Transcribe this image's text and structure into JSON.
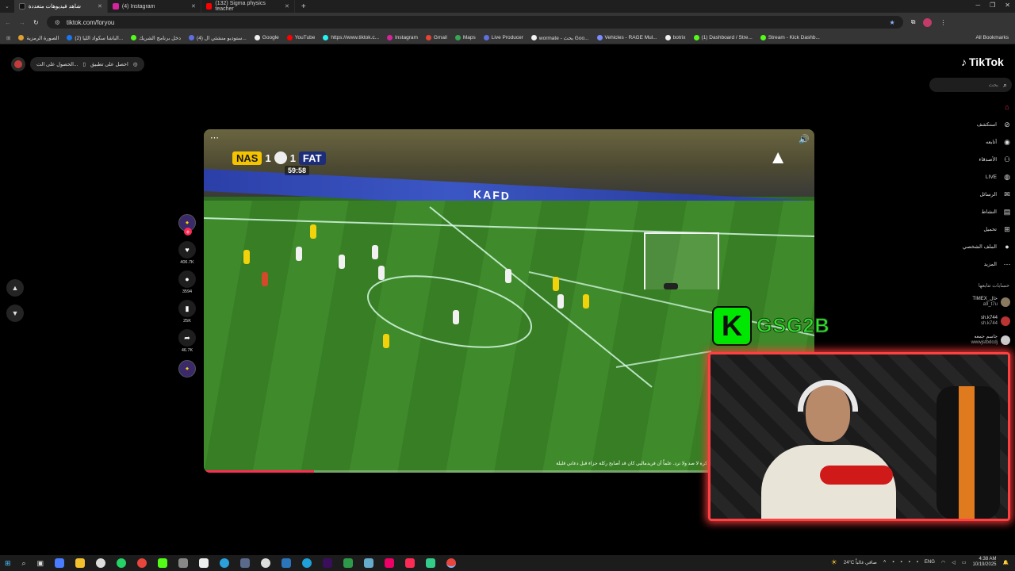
{
  "browser": {
    "tabs": [
      {
        "title": "شاهد فيديوهات متعددة",
        "active": true
      },
      {
        "title": "(4) Instagram",
        "active": false
      },
      {
        "title": "(132) Sigma physics teacher",
        "active": false
      }
    ],
    "url": "tiktok.com/foryou",
    "bookmarks": [
      {
        "label": "الصورة الرمزية",
        "color": "#e0a030"
      },
      {
        "label": "(2) الباشا سكواد الليا...",
        "color": "#1877f2"
      },
      {
        "label": "دخل برنامج الشريك",
        "color": "#53fc18"
      },
      {
        "label": "(4) ستوديو منشئي ال...",
        "color": "#5f6ee0"
      },
      {
        "label": "Google",
        "color": "#f1f1f1"
      },
      {
        "label": "YouTube",
        "color": "#ff0000"
      },
      {
        "label": "https://www.tiktok.c...",
        "color": "#25f4ee"
      },
      {
        "label": "Instagram",
        "color": "#d6249f"
      },
      {
        "label": "Gmail",
        "color": "#ea4335"
      },
      {
        "label": "Maps",
        "color": "#34a853"
      },
      {
        "label": "Live Producer",
        "color": "#5f6ee0"
      },
      {
        "label": "wormate - بحث Goo...",
        "color": "#f1f1f1"
      },
      {
        "label": "Vehicles - RAGE Mul...",
        "color": "#7a8cff"
      },
      {
        "label": "botrix",
        "color": "#f1f1f1"
      },
      {
        "label": "(1) Dashboard / Stre...",
        "color": "#53fc18"
      },
      {
        "label": "Stream - Kick Dashb...",
        "color": "#53fc18"
      }
    ],
    "all_bookmarks": "All Bookmarks"
  },
  "tiktok": {
    "get_app": "احصل على تطبيق",
    "get_coins": "الحصول على الت...",
    "logo": "TikTok",
    "search_placeholder": "بحث",
    "nav": [
      {
        "label": "",
        "icon": "home-icon",
        "color": "#fe2c55"
      },
      {
        "label": "استكشف",
        "icon": "compass-icon",
        "color": "#ddd"
      },
      {
        "label": "أتابعه",
        "icon": "following-icon",
        "color": "#ddd"
      },
      {
        "label": "الأصدقاء",
        "icon": "friends-icon",
        "color": "#ddd"
      },
      {
        "label": "LIVE",
        "icon": "live-icon",
        "color": "#ddd"
      },
      {
        "label": "الرسائل",
        "icon": "messages-icon",
        "color": "#ddd"
      },
      {
        "label": "النشاط",
        "icon": "activity-icon",
        "color": "#ddd"
      },
      {
        "label": "تحميل",
        "icon": "upload-icon",
        "color": "#ddd"
      },
      {
        "label": "الملف الشخصي",
        "icon": "profile-icon",
        "color": "#ddd"
      },
      {
        "label": "المزيد",
        "icon": "more-icon",
        "color": "#ddd"
      }
    ],
    "following_title": "حسابات تتابعها",
    "following": [
      {
        "line1": "TIMEX_خال",
        "line2": "a9_t7u"
      },
      {
        "line1": "sh.k744",
        "line2": "sh.k744"
      },
      {
        "line1": "جاسم جمعه",
        "line2": "wwwjstbdcdj"
      }
    ],
    "actions": {
      "likes": "406.7K",
      "comments": "3594",
      "saves": "25K",
      "shares": "46.7K"
    },
    "video": {
      "home_team": "NAS",
      "home_score": "1",
      "away_score": "1",
      "away_team": "FAT",
      "clock": "59:58",
      "caption": "كرة لا صد ولا ترد. علماً أن فريدماليي كان قد أصابح ركلة جزاء قبل دعاني قليلة",
      "progress_fraction": 0.18,
      "board_text": "KAFD"
    }
  },
  "stream_overlay": {
    "kick_letter": "K",
    "channel": "GSG2B"
  },
  "taskbar": {
    "weather": "24°C صافي غالباً",
    "lang": "ENG",
    "time": "4:38 AM",
    "date": "10/19/2025"
  }
}
